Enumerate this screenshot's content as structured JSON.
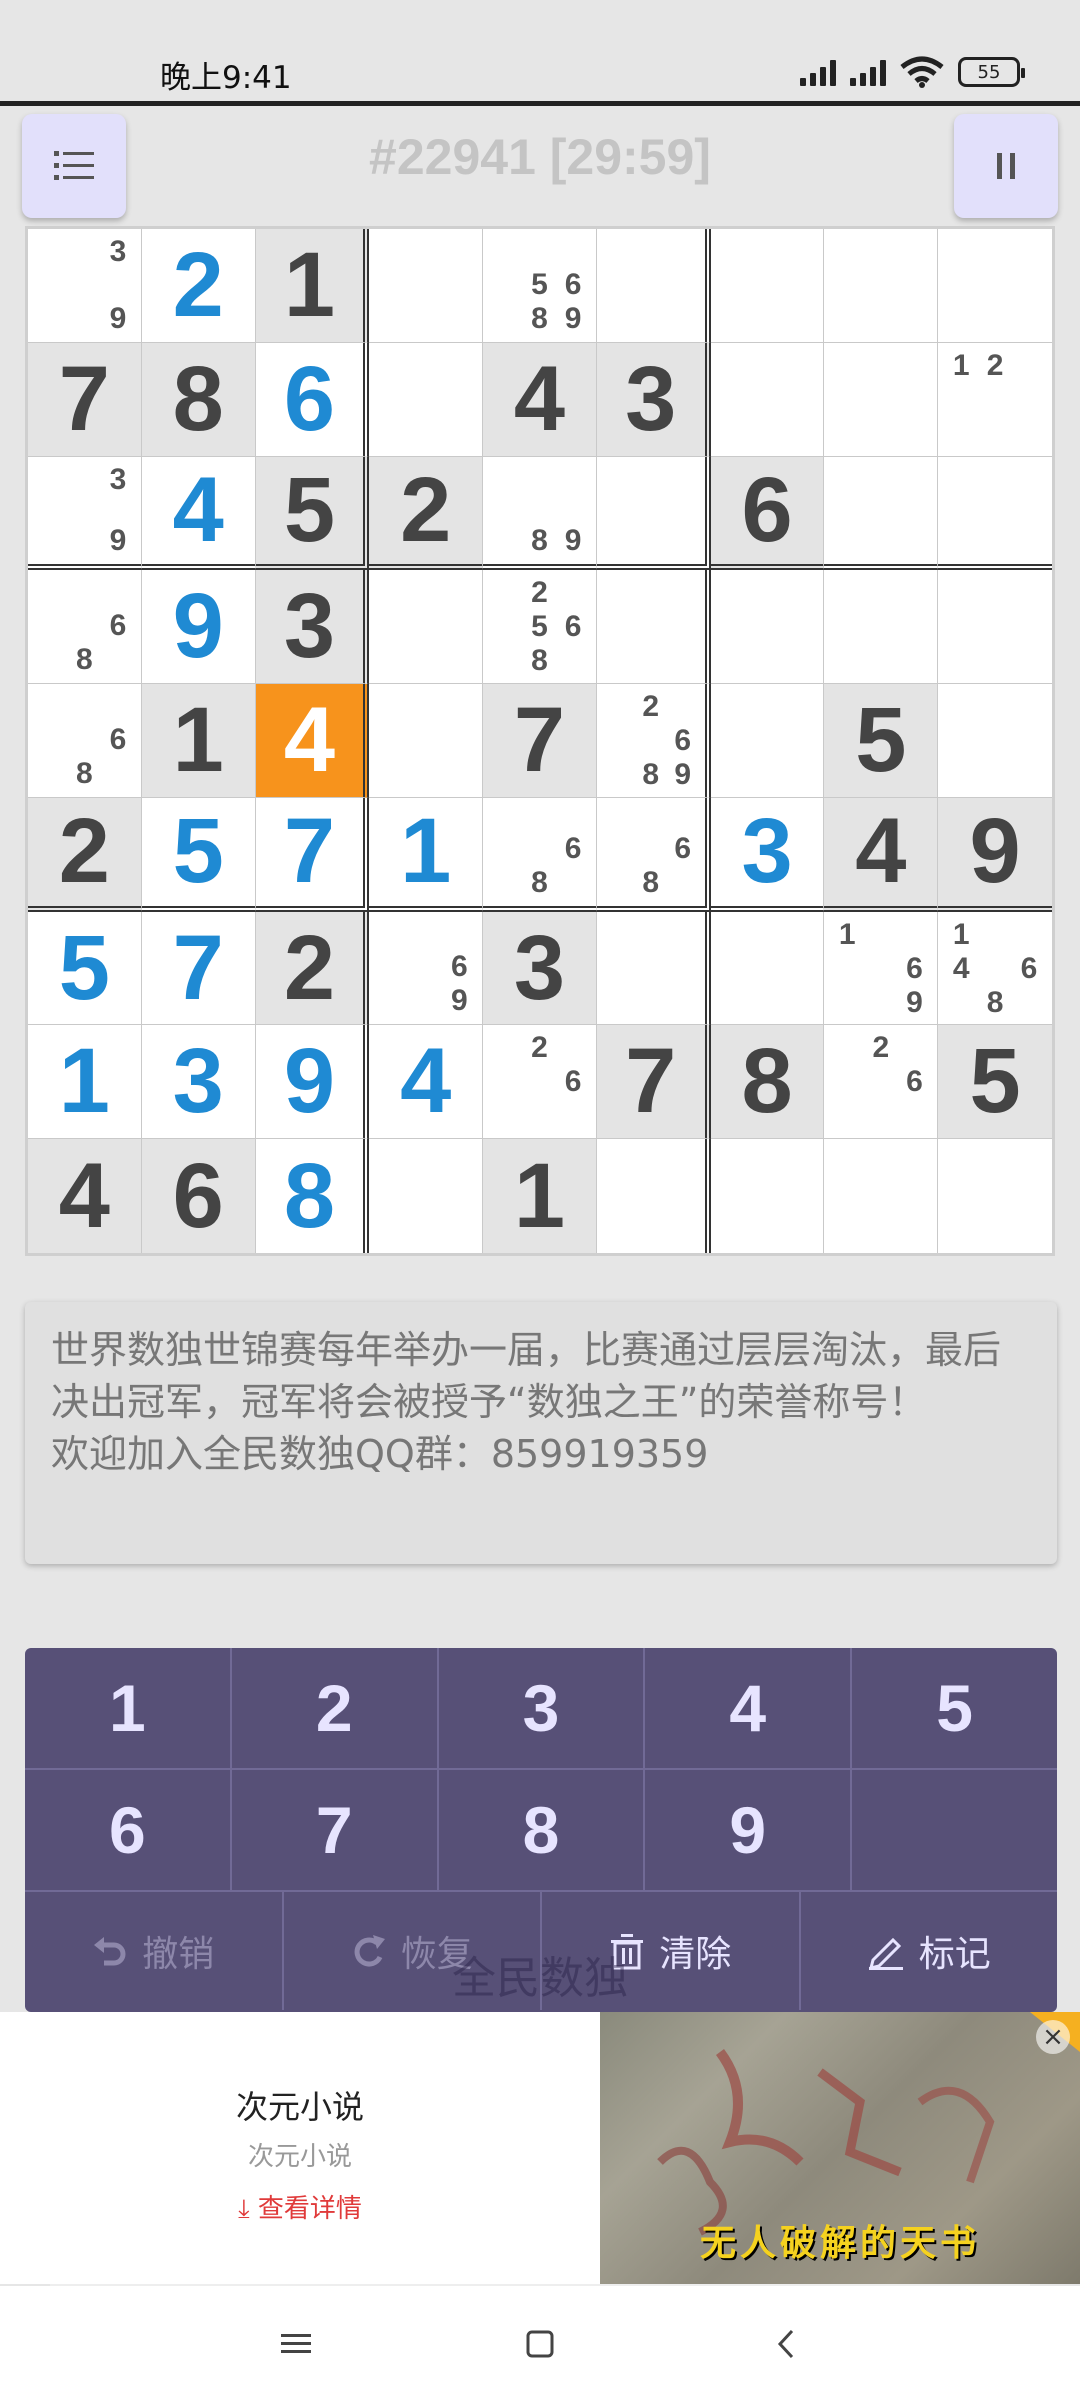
{
  "status": {
    "time": "晚上9:41",
    "battery": "55"
  },
  "header": {
    "title": "#22941 [29:59]",
    "menu_icon": "menu-icon",
    "pause_icon": "pause-icon"
  },
  "colors": {
    "given": "#444444",
    "user": "#1f8ad3",
    "selected": "#f7931c",
    "keypad": "#575077"
  },
  "board": {
    "values": [
      [
        "",
        "2",
        "1",
        "",
        "",
        "",
        "",
        "",
        ""
      ],
      [
        "7",
        "8",
        "6",
        "",
        "4",
        "3",
        "",
        "",
        ""
      ],
      [
        "",
        "4",
        "5",
        "2",
        "",
        "",
        "6",
        "",
        ""
      ],
      [
        "",
        "9",
        "3",
        "",
        "",
        "",
        "",
        "",
        ""
      ],
      [
        "",
        "1",
        "4",
        "",
        "7",
        "",
        "",
        "5",
        ""
      ],
      [
        "2",
        "5",
        "7",
        "1",
        "",
        "",
        "3",
        "4",
        "9"
      ],
      [
        "5",
        "7",
        "2",
        "",
        "3",
        "",
        "",
        "",
        ""
      ],
      [
        "1",
        "3",
        "9",
        "4",
        "",
        "7",
        "8",
        "",
        "5"
      ],
      [
        "4",
        "6",
        "8",
        "",
        "1",
        "",
        "",
        "",
        ""
      ]
    ],
    "kinds": [
      [
        "",
        "user",
        "given",
        "",
        "",
        "",
        "",
        "",
        ""
      ],
      [
        "given",
        "given",
        "user",
        "",
        "given",
        "given",
        "",
        "",
        ""
      ],
      [
        "",
        "user",
        "given",
        "given",
        "",
        "",
        "given",
        "",
        ""
      ],
      [
        "",
        "user",
        "given",
        "",
        "",
        "",
        "",
        "",
        ""
      ],
      [
        "",
        "given",
        "user",
        "",
        "given",
        "",
        "",
        "given",
        ""
      ],
      [
        "given",
        "user",
        "user",
        "user",
        "",
        "",
        "user",
        "given",
        "given"
      ],
      [
        "user",
        "user",
        "given",
        "",
        "given",
        "",
        "",
        "",
        ""
      ],
      [
        "user",
        "user",
        "user",
        "user",
        "",
        "given",
        "given",
        "",
        "given"
      ],
      [
        "given",
        "given",
        "user",
        "",
        "given",
        "",
        "",
        "",
        ""
      ]
    ],
    "shaded": [
      [
        false,
        false,
        true,
        false,
        false,
        false,
        false,
        false,
        false
      ],
      [
        true,
        true,
        false,
        false,
        true,
        true,
        false,
        false,
        false
      ],
      [
        false,
        false,
        true,
        true,
        false,
        false,
        true,
        false,
        false
      ],
      [
        false,
        false,
        true,
        false,
        false,
        false,
        false,
        false,
        false
      ],
      [
        false,
        true,
        false,
        false,
        true,
        false,
        false,
        true,
        false
      ],
      [
        true,
        false,
        false,
        false,
        false,
        false,
        false,
        true,
        true
      ],
      [
        false,
        false,
        true,
        false,
        true,
        false,
        false,
        false,
        false
      ],
      [
        false,
        false,
        false,
        false,
        false,
        true,
        true,
        false,
        true
      ],
      [
        true,
        true,
        false,
        false,
        true,
        false,
        false,
        false,
        false
      ]
    ],
    "selected": [
      4,
      2
    ],
    "notes": [
      [
        [
          3,
          9
        ],
        [],
        [],
        [],
        [
          5,
          6,
          8,
          9
        ],
        [],
        [],
        [],
        []
      ],
      [
        [],
        [],
        [],
        [],
        [],
        [],
        [],
        [],
        [
          1,
          2
        ]
      ],
      [
        [
          3,
          9
        ],
        [],
        [],
        [],
        [
          8,
          9
        ],
        [],
        [],
        [],
        []
      ],
      [
        [
          6,
          8
        ],
        [],
        [],
        [],
        [
          2,
          5,
          6,
          8
        ],
        [],
        [],
        [],
        []
      ],
      [
        [
          6,
          8
        ],
        [],
        [],
        [],
        [],
        [
          2,
          6,
          8,
          9
        ],
        [],
        [],
        []
      ],
      [
        [],
        [],
        [],
        [],
        [
          6,
          8
        ],
        [
          6,
          8
        ],
        [],
        [],
        []
      ],
      [
        [],
        [],
        [],
        [
          6,
          9
        ],
        [],
        [],
        [],
        [
          1,
          6,
          9
        ],
        [
          1,
          4,
          6,
          8
        ]
      ],
      [
        [],
        [],
        [],
        [],
        [
          2,
          6
        ],
        [],
        [],
        [
          2,
          6
        ],
        []
      ],
      [
        [],
        [],
        [],
        [],
        [],
        [],
        [],
        [],
        []
      ]
    ]
  },
  "tip": {
    "line1": "世界数独世锦赛每年举办一届，比赛通过层层淘汰，最后决出冠军，冠军将会被授予“数独之王”的荣誉称号！",
    "line2": "欢迎加入全民数独QQ群：859919359"
  },
  "keypad": {
    "numbers": [
      "1",
      "2",
      "3",
      "4",
      "5",
      "6",
      "7",
      "8",
      "9",
      ""
    ],
    "undo": "撤销",
    "redo": "恢复",
    "clear": "清除",
    "mark": "标记"
  },
  "watermark": "全民数独",
  "ad": {
    "title": "次元小说",
    "subtitle": "次元小说",
    "link": "查看详情",
    "caption": "无人破解的天书"
  }
}
